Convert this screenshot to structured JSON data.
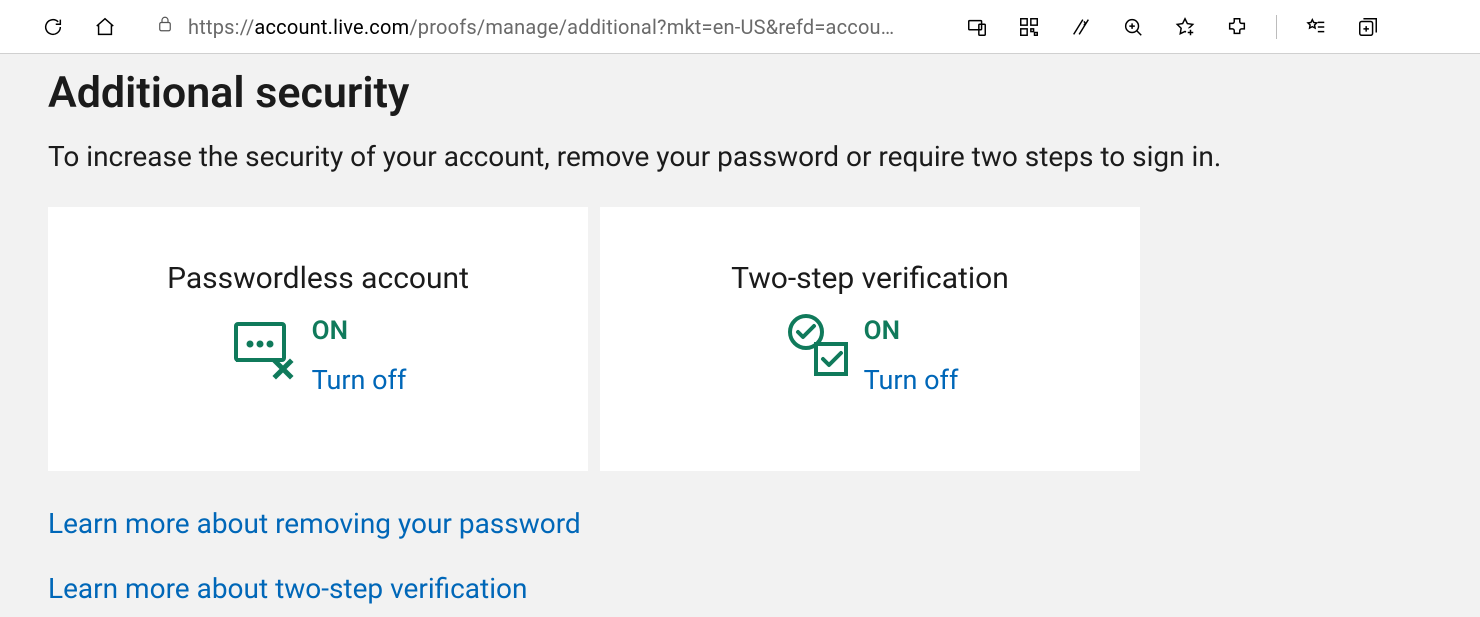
{
  "browser": {
    "url_prefix": "https://",
    "url_host": "account.live.com",
    "url_path": "/proofs/manage/additional?mkt=en-US&refd=accou…"
  },
  "page": {
    "title": "Additional security",
    "subtitle": "To increase the security of your account, remove your password or require two steps to sign in."
  },
  "cards": {
    "passwordless": {
      "title": "Passwordless account",
      "status": "ON",
      "action": "Turn off"
    },
    "twostep": {
      "title": "Two-step verification",
      "status": "ON",
      "action": "Turn off"
    }
  },
  "links": {
    "learn_passwordless": "Learn more about removing your password",
    "learn_twostep": "Learn more about two-step verification"
  },
  "colors": {
    "link": "#0067b8",
    "accent_green": "#107a5b",
    "page_bg": "#f2f2f2",
    "card_bg": "#ffffff"
  }
}
